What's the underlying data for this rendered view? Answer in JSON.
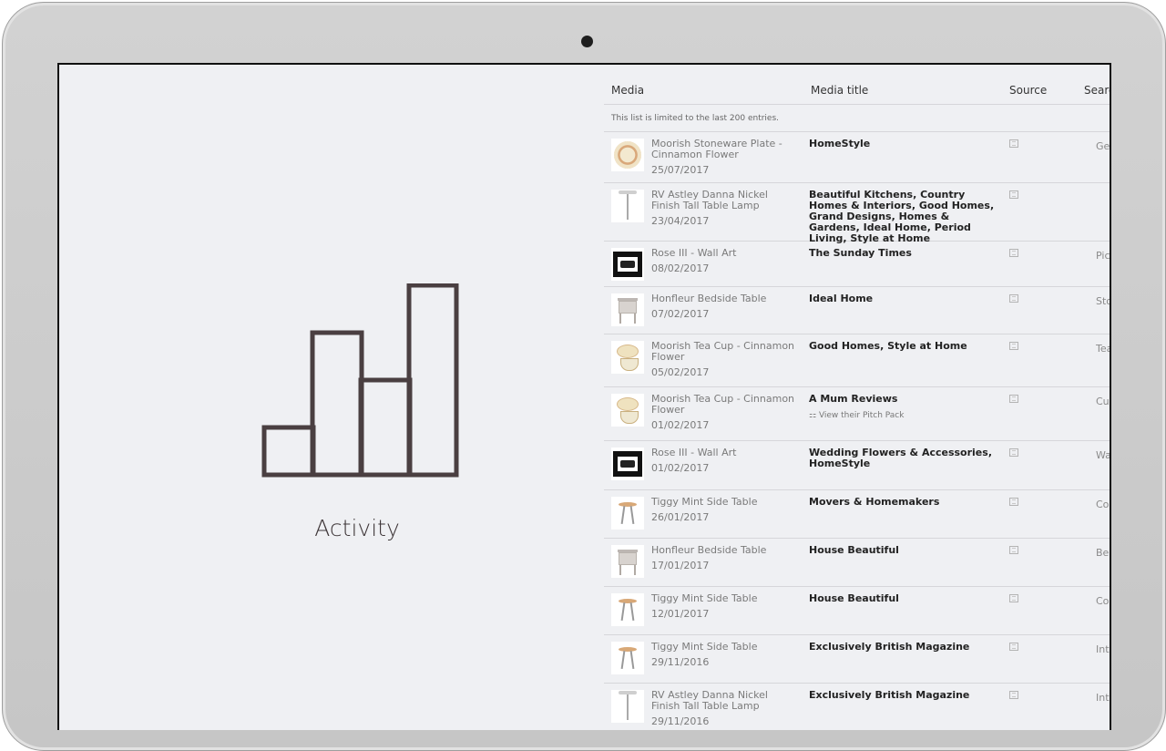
{
  "activity": {
    "label": "Activity"
  },
  "table": {
    "headers": {
      "media": "Media",
      "title": "Media title",
      "source": "Source",
      "search": "Searc"
    },
    "note": "This list is limited to the last 200 entries.",
    "rows": [
      {
        "thumb": "plate",
        "name": "Moorish Stoneware Plate - Cinnamon Flower",
        "date": "25/07/2017",
        "title": "HomeStyle",
        "pitch": "",
        "search": "Geom"
      },
      {
        "thumb": "lamp",
        "name": "RV Astley Danna Nickel Finish Tall Table Lamp",
        "date": "23/04/2017",
        "title": "Beautiful Kitchens, Country Homes & Interiors, Good Homes, Grand Designs, Homes & Gardens, Ideal Home, Period Living, Style at Home",
        "pitch": "",
        "search": ""
      },
      {
        "thumb": "frame",
        "name": "Rose III - Wall Art",
        "date": "08/02/2017",
        "title": "The Sunday Times",
        "pitch": "",
        "search": "Pictur"
      },
      {
        "thumb": "cabinet",
        "name": "Honfleur Bedside Table",
        "date": "07/02/2017",
        "title": "Ideal Home",
        "pitch": "",
        "search": "Stora"
      },
      {
        "thumb": "teacup",
        "name": "Moorish Tea Cup - Cinnamon Flower",
        "date": "05/02/2017",
        "title": "Good Homes, Style at Home",
        "pitch": "",
        "search": "Tea"
      },
      {
        "thumb": "teacup",
        "name": "Moorish Tea Cup - Cinnamon Flower",
        "date": "01/02/2017",
        "title": "A Mum Reviews",
        "pitch": "View their Pitch Pack",
        "search": "Cup"
      },
      {
        "thumb": "frame",
        "name": "Rose III - Wall Art",
        "date": "01/02/2017",
        "title": "Wedding Flowers & Accessories, HomeStyle",
        "pitch": "",
        "search": "Wall a"
      },
      {
        "thumb": "sidetable",
        "name": "Tiggy Mint Side Table",
        "date": "26/01/2017",
        "title": "Movers & Homemakers",
        "pitch": "",
        "search": "Coppe"
      },
      {
        "thumb": "cabinet",
        "name": "Honfleur Bedside Table",
        "date": "17/01/2017",
        "title": "House Beautiful",
        "pitch": "",
        "search": "Bedro"
      },
      {
        "thumb": "sidetable",
        "name": "Tiggy Mint Side Table",
        "date": "12/01/2017",
        "title": "House Beautiful",
        "pitch": "",
        "search": "Coppe"
      },
      {
        "thumb": "sidetable",
        "name": "Tiggy Mint Side Table",
        "date": "29/11/2016",
        "title": "Exclusively British Magazine",
        "pitch": "",
        "search": "Interio"
      },
      {
        "thumb": "lamp",
        "name": "RV Astley Danna Nickel Finish Tall Table Lamp",
        "date": "29/11/2016",
        "title": "Exclusively British Magazine",
        "pitch": "",
        "search": "Interio"
      }
    ]
  }
}
